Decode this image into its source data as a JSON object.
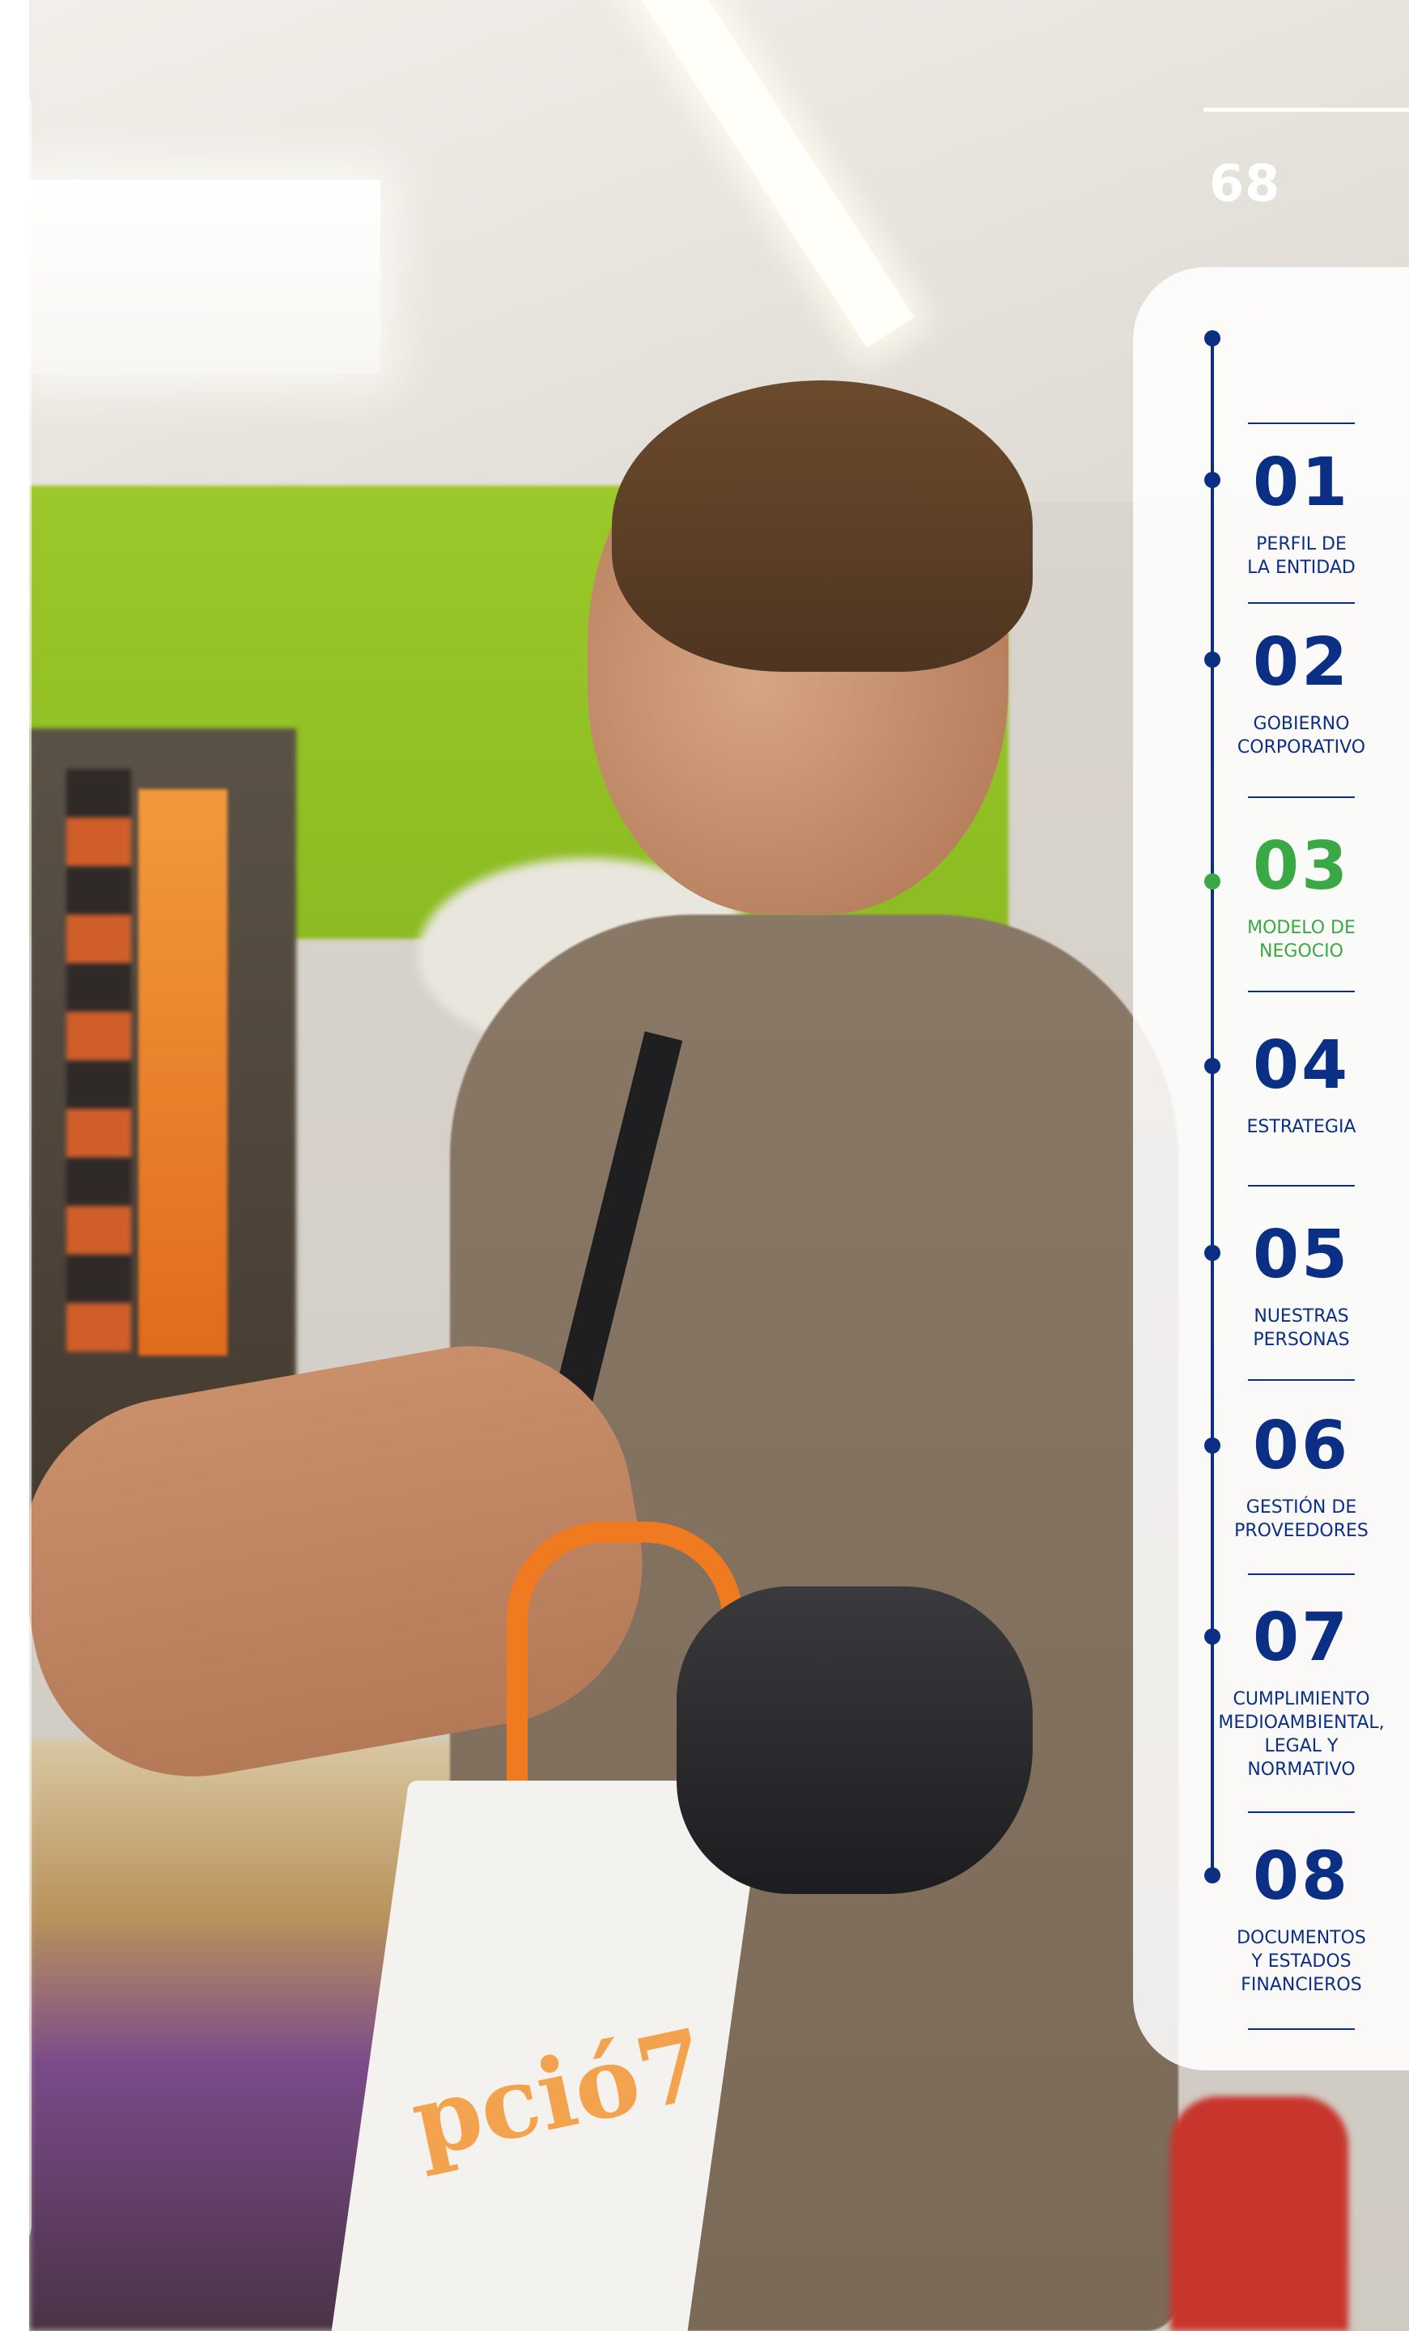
{
  "page": {
    "number": "68"
  },
  "colors": {
    "nav_primary": "#0b2f84",
    "nav_active": "#3aa844",
    "page_number": "#ffffff"
  },
  "photo": {
    "bag_print": "pció7"
  },
  "nav": {
    "items": [
      {
        "number": "01",
        "label_line1": "PERFIL DE",
        "label_line2": "LA ENTIDAD",
        "active": false
      },
      {
        "number": "02",
        "label_line1": "GOBIERNO",
        "label_line2": "CORPORATIVO",
        "active": false
      },
      {
        "number": "03",
        "label_line1": "MODELO DE",
        "label_line2": "NEGOCIO",
        "active": true
      },
      {
        "number": "04",
        "label_line1": "ESTRATEGIA",
        "active": false
      },
      {
        "number": "05",
        "label_line1": "NUESTRAS",
        "label_line2": "PERSONAS",
        "active": false
      },
      {
        "number": "06",
        "label_line1": "GESTIÓN DE",
        "label_line2": "PROVEEDORES",
        "active": false
      },
      {
        "number": "07",
        "label_line1": "CUMPLIMIENTO",
        "label_line2": "MEDIOAMBIENTAL,",
        "label_line3": "LEGAL Y",
        "label_line4": "NORMATIVO",
        "active": false
      },
      {
        "number": "08",
        "label_line1": "DOCUMENTOS",
        "label_line2": "Y ESTADOS",
        "label_line3": "FINANCIEROS",
        "active": false
      }
    ]
  }
}
